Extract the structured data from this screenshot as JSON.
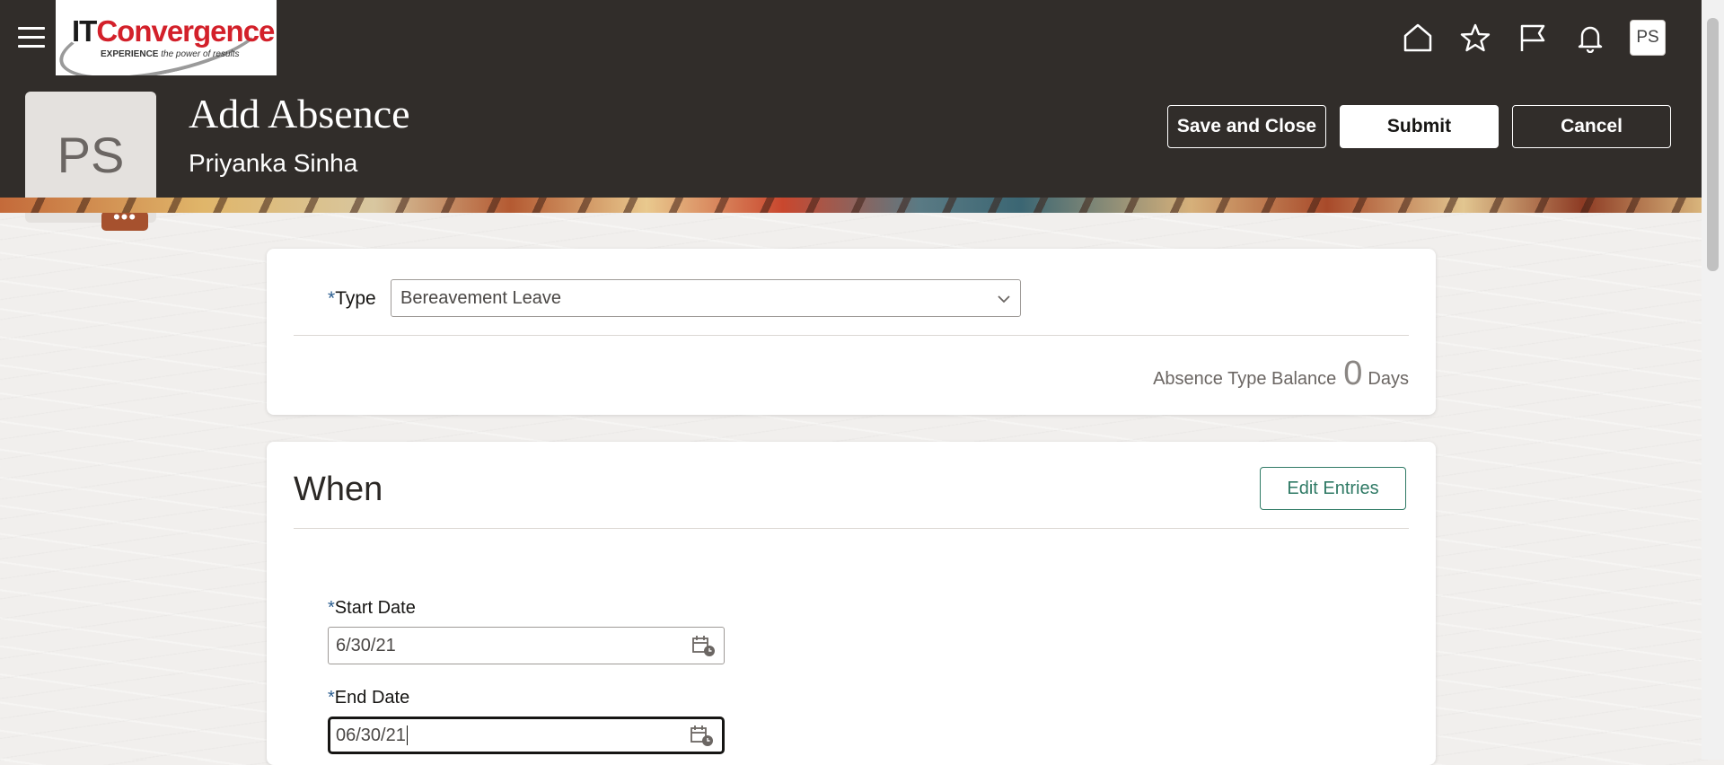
{
  "header": {
    "menu_icon": "hamburger-icon",
    "logo": {
      "brand_it": "IT",
      "brand_rest": "Convergence",
      "tagline_bold": "EXPERIENCE",
      "tagline_rest": " the power of results"
    },
    "icons": [
      "home-icon",
      "star-icon",
      "flag-icon",
      "bell-icon"
    ],
    "user_initials": "PS"
  },
  "page": {
    "title": "Add Absence",
    "person_initials": "PS",
    "person_name": "Priyanka Sinha",
    "more_label": "•••",
    "buttons": {
      "save_close": "Save and Close",
      "submit": "Submit",
      "cancel": "Cancel"
    }
  },
  "absence_type": {
    "required_mark": "*",
    "label": "Type",
    "value": "Bereavement Leave",
    "balance_label": "Absence Type Balance",
    "balance_value": "0",
    "balance_unit": "Days"
  },
  "when": {
    "title": "When",
    "edit_entries": "Edit Entries",
    "start_date": {
      "label": "Start Date",
      "value": "6/30/21"
    },
    "end_date": {
      "label": "End Date",
      "value": "06/30/21"
    }
  },
  "colors": {
    "header_bg": "#312d2a",
    "accent_green": "#2f7a65",
    "more_button": "#a6512e",
    "required": "#2a5d8f"
  }
}
